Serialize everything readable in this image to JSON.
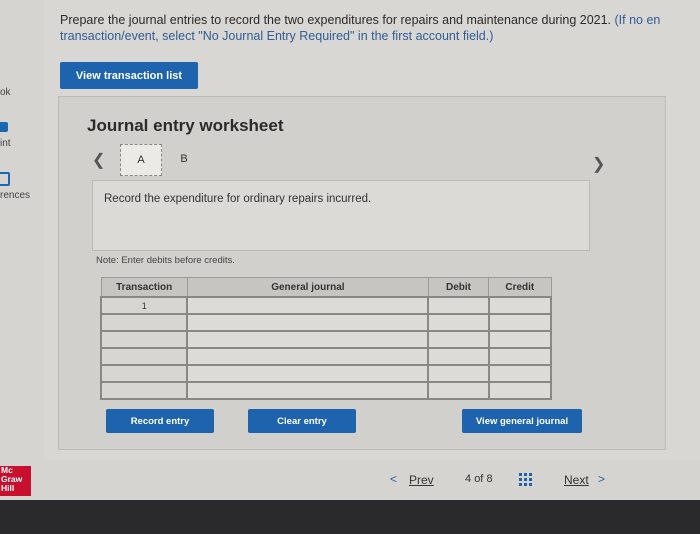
{
  "instructions": {
    "main": "Prepare the journal entries to record the two expenditures for repairs and maintenance during 2021.",
    "paren": "(If no en transaction/event, select \"No Journal Entry Required\" in the first account field.)"
  },
  "sidebar": {
    "items": [
      {
        "label": "ok"
      },
      {
        "label": "int"
      },
      {
        "label": "rences"
      }
    ]
  },
  "buttons": {
    "view_transaction_list": "View transaction list",
    "record_entry": "Record entry",
    "clear_entry": "Clear entry",
    "view_general_journal": "View general journal"
  },
  "worksheet": {
    "title": "Journal entry worksheet",
    "tabs": [
      "A",
      "B"
    ],
    "active_tab": "A",
    "description": "Record the expenditure for ordinary repairs incurred.",
    "note": "Note: Enter debits before credits."
  },
  "table": {
    "headers": [
      "Transaction",
      "General journal",
      "Debit",
      "Credit"
    ],
    "rows": [
      {
        "transaction": "1",
        "general_journal": "",
        "debit": "",
        "credit": ""
      },
      {
        "transaction": "",
        "general_journal": "",
        "debit": "",
        "credit": ""
      },
      {
        "transaction": "",
        "general_journal": "",
        "debit": "",
        "credit": ""
      },
      {
        "transaction": "",
        "general_journal": "",
        "debit": "",
        "credit": ""
      },
      {
        "transaction": "",
        "general_journal": "",
        "debit": "",
        "credit": ""
      },
      {
        "transaction": "",
        "general_journal": "",
        "debit": "",
        "credit": ""
      }
    ]
  },
  "footer": {
    "logo": [
      "Mc",
      "Graw",
      "Hill"
    ],
    "prev": "Prev",
    "page_current": "4",
    "page_of": "of",
    "page_total": "8",
    "next": "Next"
  },
  "colors": {
    "accent": "#1e63ad",
    "logo_red": "#c8102e"
  }
}
